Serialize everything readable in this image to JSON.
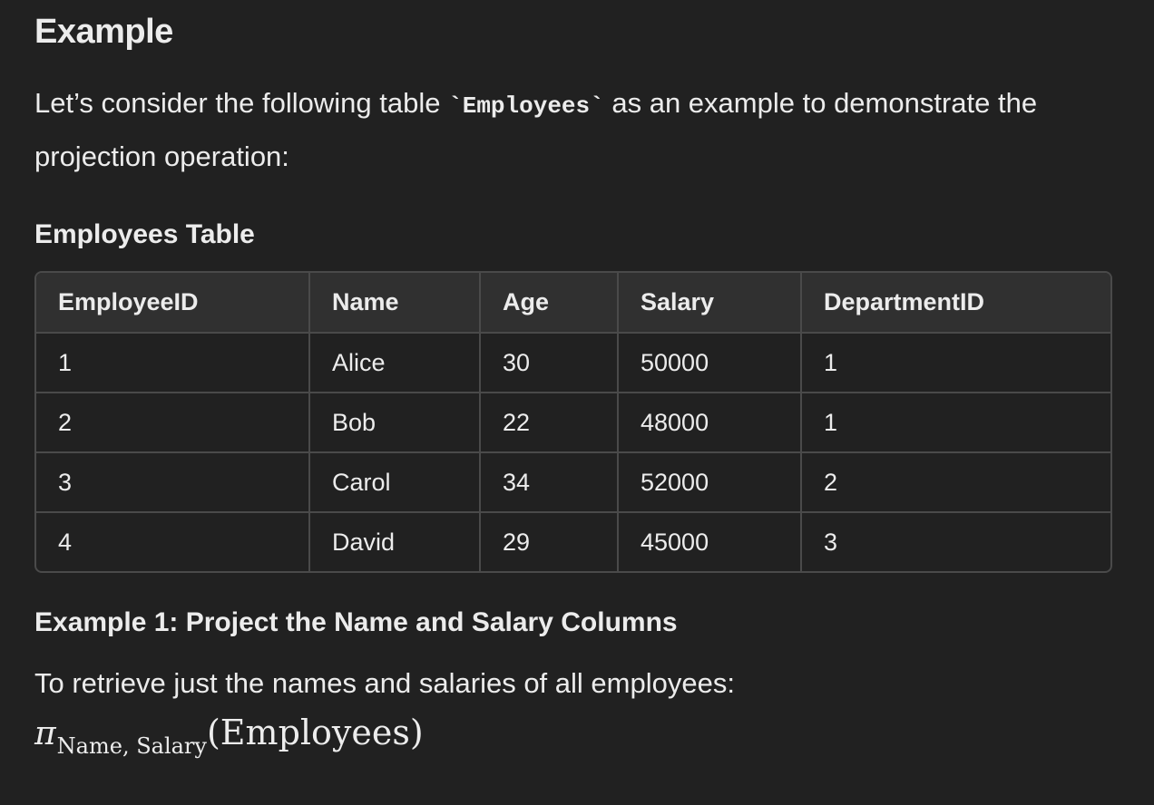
{
  "heading": "Example",
  "intro": {
    "before": "Let’s consider the following table ",
    "code": "`Employees`",
    "after": " as an example to demonstrate the projection operation:"
  },
  "table_title": "Employees Table",
  "table": {
    "headers": [
      "EmployeeID",
      "Name",
      "Age",
      "Salary",
      "DepartmentID"
    ],
    "rows": [
      [
        "1",
        "Alice",
        "30",
        "50000",
        "1"
      ],
      [
        "2",
        "Bob",
        "22",
        "48000",
        "1"
      ],
      [
        "3",
        "Carol",
        "34",
        "52000",
        "2"
      ],
      [
        "4",
        "David",
        "29",
        "45000",
        "3"
      ]
    ]
  },
  "example1": {
    "title": "Example 1: Project the Name and Salary Columns",
    "text": "To retrieve just the names and salaries of all employees:",
    "math": {
      "symbol": "π",
      "subscript": "Name, Salary",
      "argument": "(Employees)"
    }
  }
}
